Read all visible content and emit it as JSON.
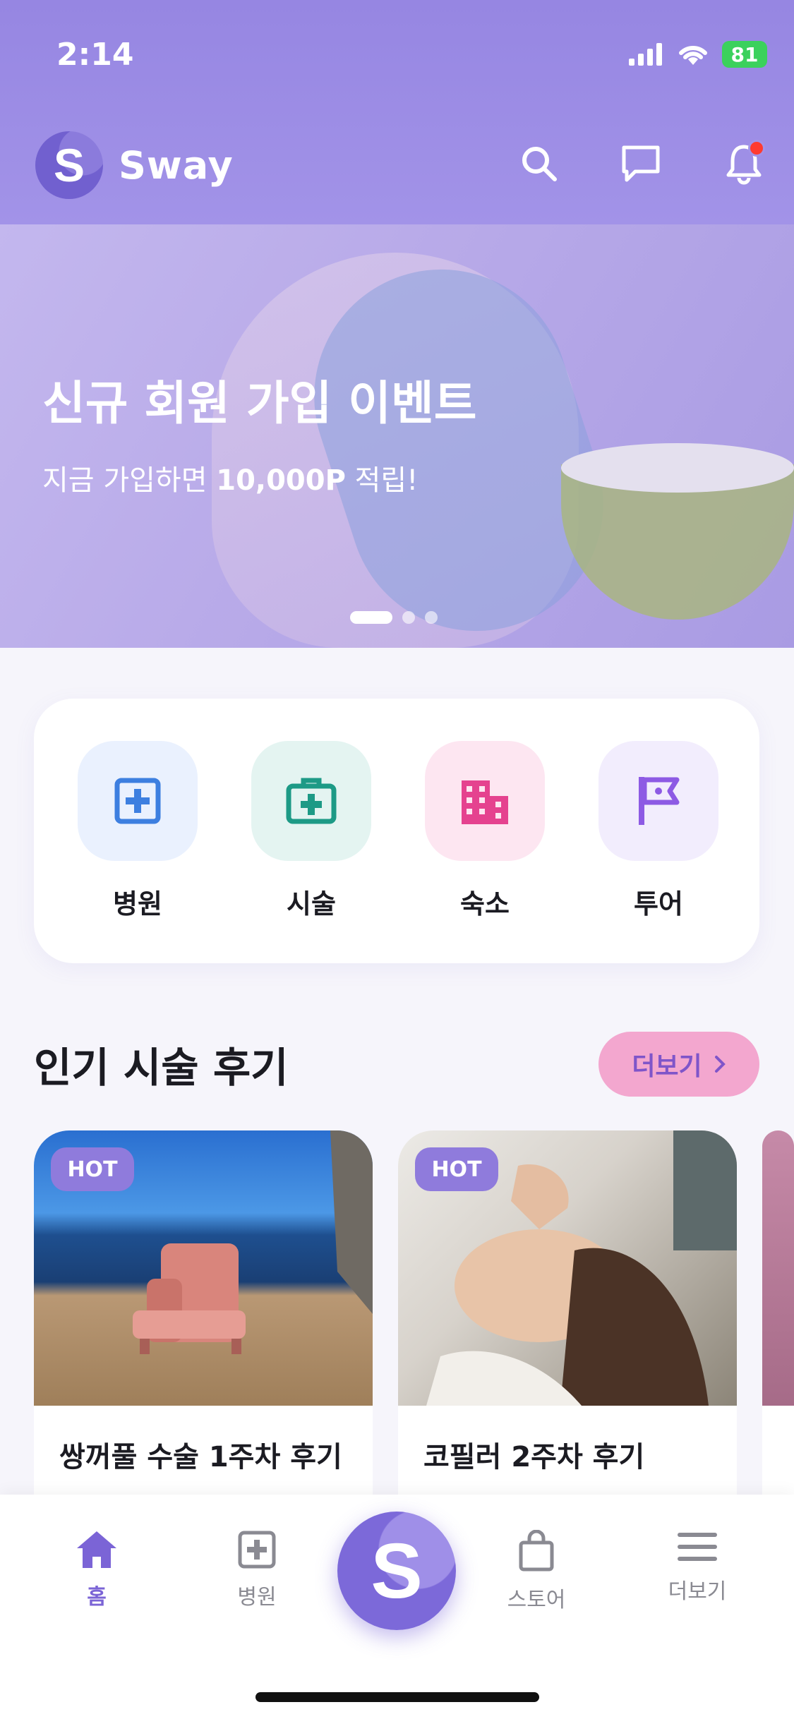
{
  "status": {
    "time": "2:14",
    "battery": "81"
  },
  "header": {
    "brand_letter": "S",
    "app_name": "Sway"
  },
  "banner": {
    "title": "신규 회원 가입 이벤트",
    "subtitle_prefix": "지금 가입하면 ",
    "subtitle_bold": "10,000P",
    "subtitle_suffix": " 적립!",
    "slides": 3,
    "active_slide": 1
  },
  "categories": [
    {
      "label": "병원",
      "icon": "hospital-plus-icon",
      "bg": "#eaf1fe",
      "color": "#3d7fe0"
    },
    {
      "label": "시술",
      "icon": "medkit-icon",
      "bg": "#e4f4f1",
      "color": "#1d9a86"
    },
    {
      "label": "숙소",
      "icon": "building-icon",
      "bg": "#fde6f1",
      "color": "#e5428f"
    },
    {
      "label": "투어",
      "icon": "flag-icon",
      "bg": "#f2edfd",
      "color": "#8d5ae4"
    }
  ],
  "section": {
    "title": "인기 시술 후기",
    "more_label": "더보기"
  },
  "reviews": [
    {
      "badge": "HOT",
      "title": "쌍꺼풀 수술 1주차 후기"
    },
    {
      "badge": "HOT",
      "title": "코필러 2주차 후기"
    }
  ],
  "tabbar": {
    "tabs": [
      {
        "label": "홈",
        "icon": "home-icon",
        "active": true
      },
      {
        "label": "병원",
        "icon": "hospital-plus-icon"
      },
      {
        "label": "스토어",
        "icon": "shopping-bag-icon"
      },
      {
        "label": "더보기",
        "icon": "menu-icon"
      }
    ],
    "center_letter": "S"
  },
  "colors": {
    "brand": "#9686e2",
    "accent_pink": "#f3a7cf",
    "active_tab": "#7b64d6"
  }
}
